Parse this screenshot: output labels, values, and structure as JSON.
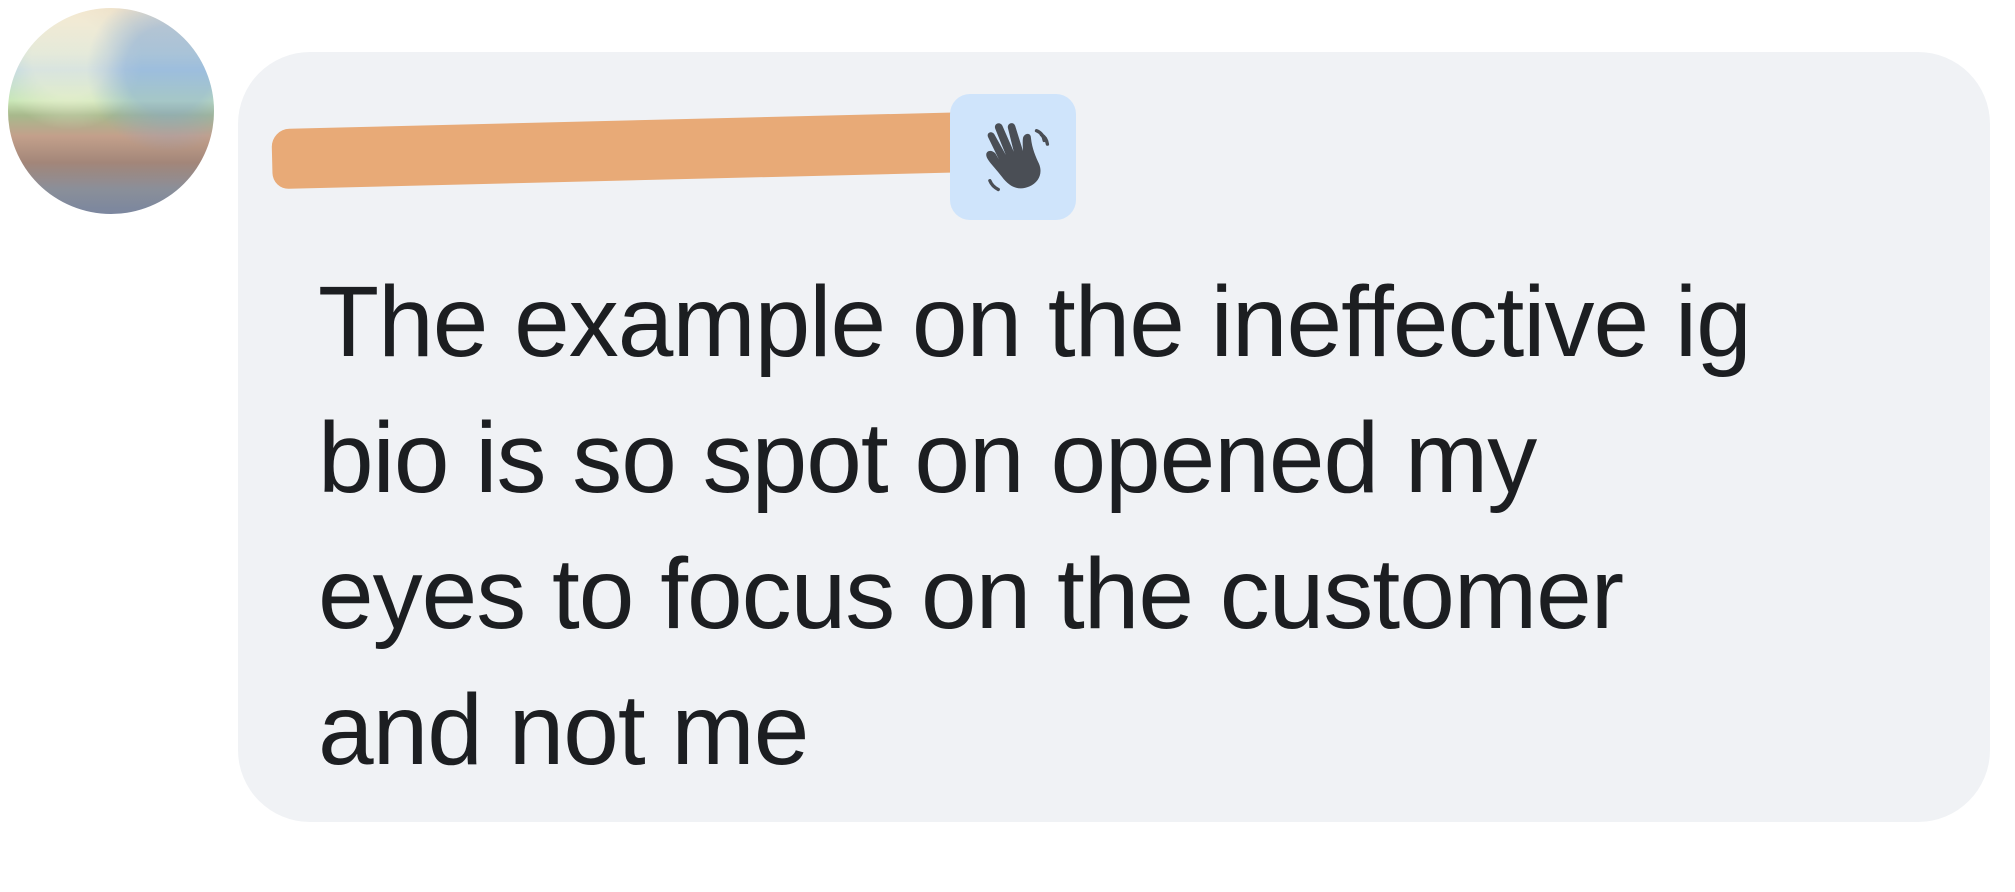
{
  "comment": {
    "author_name": "",
    "author_badge": "waving-hand-icon",
    "text": "The example on the ineffective ig\nbio is so spot on opened my\neyes to focus on the customer\nand not me"
  },
  "colors": {
    "bubble_background": "#f0f2f5",
    "redaction": "#e8aa77",
    "badge_background": "#cfe4fb",
    "text": "#1c1e21"
  }
}
